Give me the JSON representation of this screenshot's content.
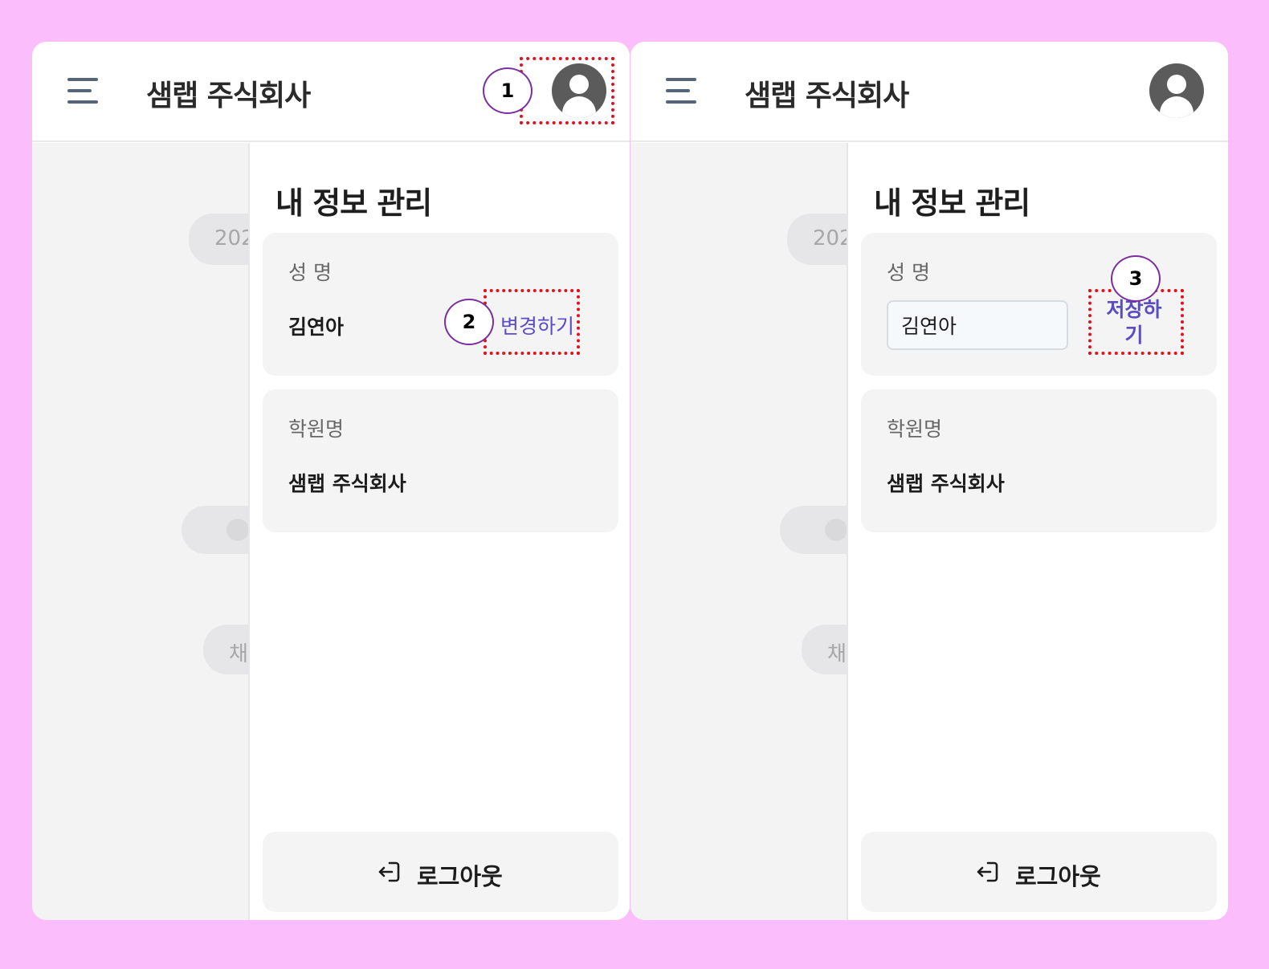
{
  "brand": "샘랩 주식회사",
  "drawer_title": "내 정보 관리",
  "name_card": {
    "label": "성 명",
    "value": "김연아",
    "change_label": "변경하기",
    "input_value": "김연아",
    "save_label_line1": "저장하",
    "save_label_line2": "기"
  },
  "academy_card": {
    "label": "학원명",
    "value": "샘랩 주식회사"
  },
  "logout_label": "로그아웃",
  "background": {
    "date_fragment": "202",
    "chat_fragment": "채"
  },
  "markers": [
    "1",
    "2",
    "3"
  ],
  "icons": {
    "menu": "hamburger-menu-icon",
    "avatar": "user-avatar-icon",
    "logout": "logout-icon"
  },
  "colors": {
    "canvas_background": "#fbbdfb",
    "accent": "#5b4bc4",
    "highlight_box": "#e0131c",
    "marker_border": "#7a2ea0"
  }
}
